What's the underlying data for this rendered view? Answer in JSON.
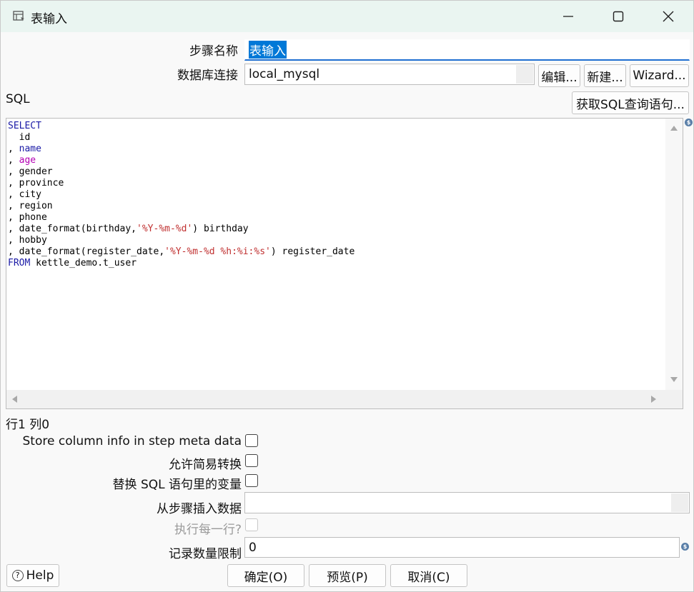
{
  "window": {
    "title": "表输入"
  },
  "form": {
    "step_name_label": "步骤名称",
    "step_name_value": "表输入",
    "db_conn_label": "数据库连接",
    "db_conn_value": "local_mysql",
    "edit_label": "编辑...",
    "new_label": "新建...",
    "wizard_label": "Wizard...",
    "sql_label": "SQL",
    "get_sql_label": "获取SQL查询语句..."
  },
  "sql_lines": [
    "SELECT",
    "  id",
    ", name",
    ", age",
    ", gender",
    ", province",
    ", city",
    ", region",
    ", phone",
    ", date_format(birthday,'%Y-%m-%d') birthday",
    ", hobby",
    ", date_format(register_date,'%Y-%m-%d %h:%i:%s') register_date",
    "FROM kettle_demo.t_user"
  ],
  "status": {
    "position": "行1 列0"
  },
  "options": {
    "store_column_info_label": "Store column info in step meta data",
    "lazy_conversion_label": "允许简易转换",
    "replace_variables_label": "替换 SQL 语句里的变量",
    "insert_from_step_label": "从步骤插入数据",
    "insert_from_step_value": "",
    "execute_each_row_label": "执行每一行?",
    "limit_label": "记录数量限制",
    "limit_value": "0"
  },
  "footer": {
    "help_label": "Help",
    "ok_label": "确定(O)",
    "preview_label": "预览(P)",
    "cancel_label": "取消(C)"
  },
  "icons": {
    "variable_icon_glyph": "$",
    "help_icon_glyph": "?"
  }
}
